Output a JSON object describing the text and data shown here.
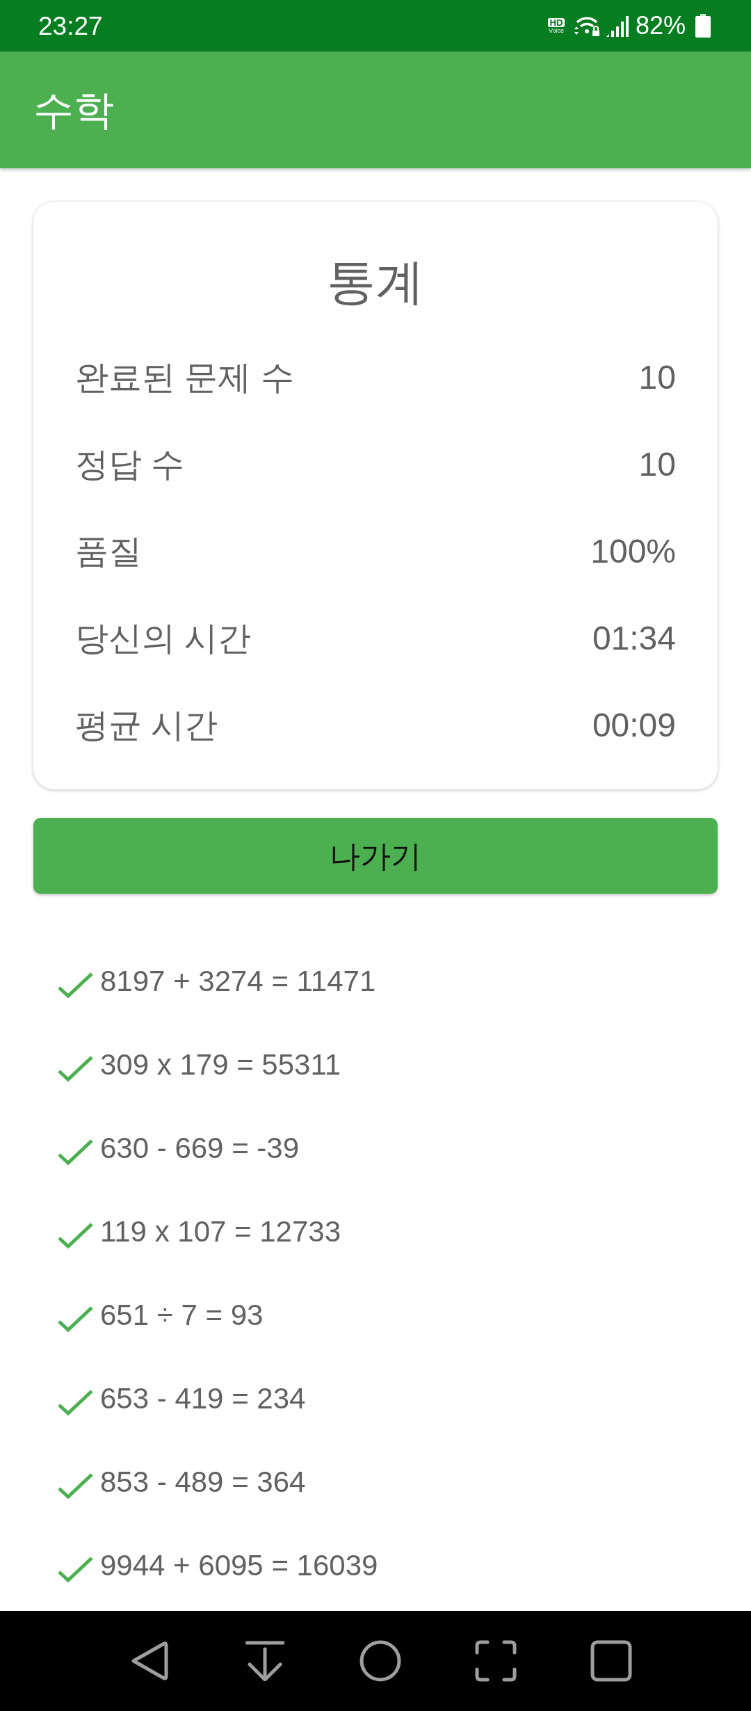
{
  "status_bar": {
    "time": "23:27",
    "hd_badge": "HD",
    "voice_label": "Voice",
    "battery_percent": "82%"
  },
  "app_bar": {
    "title": "수학"
  },
  "stats_card": {
    "title": "통계",
    "rows": [
      {
        "label": "완료된 문제 수",
        "value": "10"
      },
      {
        "label": "정답 수",
        "value": "10"
      },
      {
        "label": "품질",
        "value": "100%"
      },
      {
        "label": "당신의 시간",
        "value": "01:34"
      },
      {
        "label": "평균 시간",
        "value": "00:09"
      }
    ]
  },
  "exit_button": {
    "label": "나가기"
  },
  "results": [
    {
      "expression": "8197 + 3274 = 11471",
      "correct": true
    },
    {
      "expression": "309 x 179 = 55311",
      "correct": true
    },
    {
      "expression": "630 - 669 = -39",
      "correct": true
    },
    {
      "expression": "119 x 107 = 12733",
      "correct": true
    },
    {
      "expression": "651 ÷ 7 = 93",
      "correct": true
    },
    {
      "expression": "653 - 419 = 234",
      "correct": true
    },
    {
      "expression": "853 - 489 = 364",
      "correct": true
    },
    {
      "expression": "9944 + 6095 = 16039",
      "correct": true
    }
  ]
}
